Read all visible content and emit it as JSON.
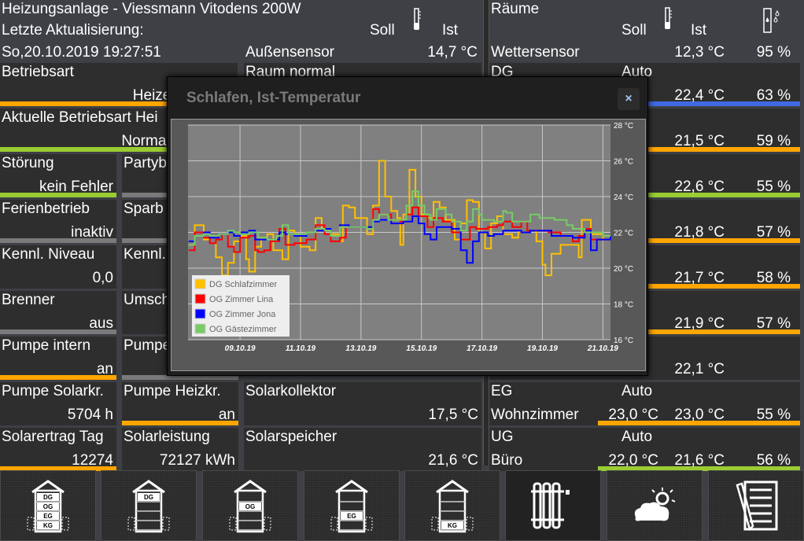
{
  "header": {
    "title": "Heizungsanlage - Viessmann Vitodens 200W",
    "last_update_label": "Letzte Aktualisierung:",
    "last_update_value": "So,20.10.2019 19:27:51",
    "soll": "Soll",
    "ist": "Ist",
    "outdoor_label": "Außensensor",
    "outdoor_value": "14,7 °C"
  },
  "colors": {
    "orange": "#ffa500",
    "green": "#9acd32",
    "gray": "#7a7a7a",
    "blue": "#4169e1"
  },
  "left_tiles": [
    {
      "label": "Betriebsart",
      "value": "Heizen und Wa",
      "bar": "orange",
      "col": "wide",
      "row": 0
    },
    {
      "label": "Raum normal",
      "value": "",
      "bar": "",
      "col": "c3",
      "row": 0
    },
    {
      "label": "Aktuelle Betriebsart Hei",
      "value": "Normalbetrieb (S",
      "bar": "green",
      "col": "wide",
      "row": 1
    },
    {
      "label": "Störung",
      "value": "kein Fehler",
      "bar": "green",
      "col": "c1",
      "row": 2
    },
    {
      "label": "Partyb",
      "value": "",
      "bar": "gray",
      "col": "c2",
      "row": 2
    },
    {
      "label": "Ferienbetrieb",
      "value": "inaktiv",
      "bar": "gray",
      "col": "c1",
      "row": 3
    },
    {
      "label": "Sparb",
      "value": "",
      "bar": "gray",
      "col": "c2",
      "row": 3
    },
    {
      "label": "Kennl. Niveau",
      "value": "0,0",
      "bar": "",
      "col": "c1",
      "row": 4
    },
    {
      "label": "Kennl.",
      "value": "",
      "bar": "",
      "col": "c2",
      "row": 4
    },
    {
      "label": "Brenner",
      "value": "aus",
      "bar": "gray",
      "col": "c1",
      "row": 5
    },
    {
      "label": "Umsch",
      "value": "",
      "bar": "",
      "col": "c2",
      "row": 5
    },
    {
      "label": "Pumpe intern",
      "value": "an",
      "bar": "orange",
      "col": "c1",
      "row": 6
    },
    {
      "label": "Pumpe",
      "value": "",
      "bar": "gray",
      "col": "c2",
      "row": 6
    },
    {
      "label": "Pumpe Solarkr.",
      "value": "5704 h",
      "bar": "",
      "col": "c1",
      "row": 7
    },
    {
      "label": "Pumpe Heizkr.",
      "value": "an",
      "bar": "orange",
      "col": "c2",
      "row": 7
    },
    {
      "label": "Solarkollektor",
      "value": "17,5 °C",
      "bar": "",
      "col": "c3",
      "row": 7
    },
    {
      "label": "Solarertrag Tag",
      "value": "12274",
      "bar": "orange",
      "col": "c1",
      "row": 8
    },
    {
      "label": "Solarleistung",
      "value": "72127 kWh",
      "bar": "",
      "col": "c2",
      "row": 8
    },
    {
      "label": "Solarspeicher",
      "value": "21,6 °C",
      "bar": "",
      "col": "c3",
      "row": 8
    }
  ],
  "rooms": {
    "title": "Räume",
    "soll": "Soll",
    "ist": "Ist",
    "weather_label": "Wettersensor",
    "weather_temp": "12,3 °C",
    "weather_hum": "95 %",
    "rows": [
      {
        "n1": "DG",
        "n2": "",
        "mode": "Auto",
        "soll": "",
        "ist": "22,4 °C",
        "hum": "63 %",
        "bar": "blue"
      },
      {
        "n1": "",
        "n2": "",
        "mode": "",
        "soll": "",
        "ist": "21,5 °C",
        "hum": "59 %",
        "bar": "orange"
      },
      {
        "n1": "",
        "n2": "",
        "mode": "",
        "soll": "",
        "ist": "22,6 °C",
        "hum": "55 %",
        "bar": "green"
      },
      {
        "n1": "",
        "n2": "",
        "mode": "",
        "soll": "",
        "ist": "21,8 °C",
        "hum": "57 %",
        "bar": "orange"
      },
      {
        "n1": "",
        "n2": "",
        "mode": "",
        "soll": "",
        "ist": "21,7 °C",
        "hum": "58 %",
        "bar": "orange"
      },
      {
        "n1": "",
        "n2": "",
        "mode": "",
        "soll": "",
        "ist": "21,9 °C",
        "hum": "57 %",
        "bar": "orange"
      },
      {
        "n1": "",
        "n2": "",
        "mode": "",
        "soll": "",
        "ist": "22,1 °C",
        "hum": "",
        "bar": ""
      },
      {
        "n1": "EG",
        "n2": "Wohnzimmer",
        "mode": "Auto",
        "soll": "23,0 °C",
        "ist": "23,0 °C",
        "hum": "55 %",
        "bar": "orange"
      },
      {
        "n1": "UG",
        "n2": "Büro",
        "mode": "Auto",
        "soll": "22,0 °C",
        "ist": "21,6 °C",
        "hum": "56 %",
        "bar": "green"
      }
    ]
  },
  "nav": [
    {
      "name": "house-all-floors",
      "labels": [
        "DG",
        "OG",
        "EG",
        "KG"
      ],
      "hl": [
        0,
        1,
        2,
        3
      ]
    },
    {
      "name": "house-dg",
      "labels": [
        "DG"
      ],
      "hl": [
        0
      ]
    },
    {
      "name": "house-og",
      "labels": [
        "OG"
      ],
      "hl": [
        1
      ]
    },
    {
      "name": "house-eg",
      "labels": [
        "EG"
      ],
      "hl": [
        2
      ]
    },
    {
      "name": "house-kg",
      "labels": [
        "KG"
      ],
      "hl": [
        3
      ]
    },
    {
      "name": "radiator",
      "labels": [],
      "hl": [],
      "active": true
    },
    {
      "name": "weather",
      "labels": [],
      "hl": []
    },
    {
      "name": "notes",
      "labels": [],
      "hl": []
    }
  ],
  "dialog": {
    "title": "Schlafen, Ist-Temperatur",
    "close": "×"
  },
  "chart_data": {
    "type": "line",
    "title": "Schlafen, Ist-Temperatur",
    "x_unit": "days since 07.10.19 00:00",
    "xlim": [
      0.28,
      14.25
    ],
    "ylim": [
      16,
      28
    ],
    "yticks": [
      "16 °C",
      "18 °C",
      "20 °C",
      "22 °C",
      "24 °C",
      "26 °C",
      "28 °C"
    ],
    "ytick_values": [
      16,
      18,
      20,
      22,
      24,
      26,
      28
    ],
    "xticks": [
      "09.10.19",
      "11.10.19",
      "13.10.19",
      "15.10.19",
      "17.10.19",
      "19.10.19",
      "21.10.19"
    ],
    "xtick_values": [
      2,
      4,
      6,
      8,
      10,
      12,
      14
    ],
    "grid": true,
    "legend": "bottom-left",
    "series": [
      {
        "name": "DG Schlafzimmer",
        "color": "#ffc000",
        "points": [
          [
            0.3,
            21.3
          ],
          [
            0.5,
            22.4
          ],
          [
            0.8,
            21.6
          ],
          [
            1.0,
            21.8
          ],
          [
            1.2,
            20.6
          ],
          [
            1.4,
            19.6
          ],
          [
            1.6,
            20.3
          ],
          [
            1.8,
            21.5
          ],
          [
            2.0,
            21.8
          ],
          [
            2.2,
            20.5
          ],
          [
            2.3,
            19.8
          ],
          [
            2.5,
            21.2
          ],
          [
            2.7,
            21.7
          ],
          [
            2.9,
            21.9
          ],
          [
            3.1,
            21.0
          ],
          [
            3.4,
            20.5
          ],
          [
            3.6,
            22.1
          ],
          [
            3.8,
            21.9
          ],
          [
            4.0,
            21.2
          ],
          [
            4.3,
            21.0
          ],
          [
            4.5,
            22.8
          ],
          [
            4.7,
            22.2
          ],
          [
            5.0,
            21.9
          ],
          [
            5.3,
            21.5
          ],
          [
            5.4,
            23.5
          ],
          [
            5.6,
            23.4
          ],
          [
            5.8,
            22.8
          ],
          [
            6.2,
            21.9
          ],
          [
            6.4,
            23.5
          ],
          [
            6.6,
            26.0
          ],
          [
            6.8,
            24.0
          ],
          [
            7.0,
            23.2
          ],
          [
            7.2,
            22.8
          ],
          [
            7.3,
            21.3
          ],
          [
            7.4,
            23.0
          ],
          [
            7.6,
            25.5
          ],
          [
            7.8,
            24.0
          ],
          [
            8.0,
            23.0
          ],
          [
            8.2,
            22.8
          ],
          [
            8.4,
            23.7
          ],
          [
            8.6,
            23.4
          ],
          [
            8.8,
            22.7
          ],
          [
            9.1,
            21.6
          ],
          [
            9.3,
            22.5
          ],
          [
            9.5,
            23.8
          ],
          [
            9.7,
            23.7
          ],
          [
            9.9,
            22.0
          ],
          [
            10.1,
            21.1
          ],
          [
            10.3,
            22.5
          ],
          [
            10.5,
            22.9
          ],
          [
            10.7,
            21.9
          ],
          [
            11.0,
            21.7
          ],
          [
            11.2,
            22.0
          ],
          [
            11.5,
            22.1
          ],
          [
            11.8,
            21.5
          ],
          [
            12.0,
            20.2
          ],
          [
            12.1,
            19.6
          ],
          [
            12.3,
            20.8
          ],
          [
            12.6,
            21.3
          ],
          [
            13.0,
            21.3
          ],
          [
            13.2,
            20.6
          ],
          [
            13.3,
            22.7
          ],
          [
            13.6,
            21.9
          ],
          [
            14.0,
            21.6
          ],
          [
            14.25,
            21.8
          ]
        ]
      },
      {
        "name": "OG Zimmer Lina",
        "color": "#ff0000",
        "points": [
          [
            0.3,
            21.0
          ],
          [
            0.5,
            22.0
          ],
          [
            0.8,
            21.7
          ],
          [
            1.0,
            21.4
          ],
          [
            1.2,
            21.6
          ],
          [
            1.4,
            21.9
          ],
          [
            1.6,
            21.2
          ],
          [
            1.8,
            20.9
          ],
          [
            2.0,
            21.7
          ],
          [
            2.3,
            21.8
          ],
          [
            2.5,
            21.0
          ],
          [
            2.6,
            20.9
          ],
          [
            2.8,
            21.0
          ],
          [
            3.0,
            21.5
          ],
          [
            3.3,
            22.2
          ],
          [
            3.5,
            21.3
          ],
          [
            3.8,
            21.4
          ],
          [
            4.2,
            21.6
          ],
          [
            4.5,
            22.4
          ],
          [
            4.8,
            21.9
          ],
          [
            5.0,
            21.5
          ],
          [
            5.3,
            21.7
          ],
          [
            5.5,
            22.3
          ],
          [
            5.8,
            22.3
          ],
          [
            6.2,
            22.3
          ],
          [
            6.4,
            23.3
          ],
          [
            6.6,
            23.0
          ],
          [
            7.0,
            22.7
          ],
          [
            7.3,
            22.6
          ],
          [
            7.5,
            23.0
          ],
          [
            7.7,
            23.4
          ],
          [
            7.9,
            22.9
          ],
          [
            8.2,
            22.3
          ],
          [
            8.4,
            22.8
          ],
          [
            8.7,
            22.6
          ],
          [
            9.0,
            22.0
          ],
          [
            9.3,
            21.6
          ],
          [
            9.6,
            22.3
          ],
          [
            9.8,
            22.2
          ],
          [
            10.2,
            22.3
          ],
          [
            10.5,
            22.4
          ],
          [
            10.7,
            22.6
          ],
          [
            11.0,
            22.3
          ],
          [
            11.3,
            22.6
          ],
          [
            11.5,
            22.1
          ],
          [
            11.8,
            22.1
          ],
          [
            12.2,
            22.0
          ],
          [
            12.6,
            21.8
          ],
          [
            13.0,
            21.5
          ],
          [
            13.2,
            21.8
          ],
          [
            13.4,
            22.2
          ],
          [
            13.6,
            21.6
          ],
          [
            14.0,
            21.6
          ],
          [
            14.25,
            21.7
          ]
        ]
      },
      {
        "name": "OG Zimmer Jona",
        "color": "#0000ff",
        "points": [
          [
            0.3,
            21.5
          ],
          [
            0.5,
            21.8
          ],
          [
            0.8,
            22.0
          ],
          [
            1.0,
            21.7
          ],
          [
            1.3,
            21.9
          ],
          [
            1.6,
            22.0
          ],
          [
            1.8,
            21.8
          ],
          [
            2.0,
            22.0
          ],
          [
            2.3,
            22.1
          ],
          [
            2.5,
            21.6
          ],
          [
            2.8,
            21.6
          ],
          [
            3.0,
            21.6
          ],
          [
            3.3,
            22.0
          ],
          [
            3.5,
            21.9
          ],
          [
            3.8,
            21.8
          ],
          [
            4.2,
            22.0
          ],
          [
            4.5,
            22.1
          ],
          [
            4.8,
            22.2
          ],
          [
            5.0,
            21.8
          ],
          [
            5.3,
            22.4
          ],
          [
            5.6,
            22.3
          ],
          [
            6.2,
            22.3
          ],
          [
            6.4,
            22.6
          ],
          [
            6.6,
            22.7
          ],
          [
            7.0,
            22.5
          ],
          [
            7.4,
            22.6
          ],
          [
            7.7,
            22.9
          ],
          [
            7.9,
            22.5
          ],
          [
            8.1,
            21.9
          ],
          [
            8.3,
            21.6
          ],
          [
            8.5,
            22.3
          ],
          [
            9.0,
            22.2
          ],
          [
            9.3,
            21.0
          ],
          [
            9.5,
            20.3
          ],
          [
            9.7,
            21.5
          ],
          [
            9.9,
            22.0
          ],
          [
            10.2,
            21.8
          ],
          [
            10.4,
            21.9
          ],
          [
            10.7,
            22.1
          ],
          [
            11.0,
            22.1
          ],
          [
            11.3,
            22.0
          ],
          [
            11.6,
            22.1
          ],
          [
            11.9,
            22.1
          ],
          [
            12.3,
            21.8
          ],
          [
            12.7,
            21.8
          ],
          [
            13.0,
            21.7
          ],
          [
            13.2,
            21.7
          ],
          [
            13.4,
            22.1
          ],
          [
            13.6,
            21.0
          ],
          [
            13.8,
            21.6
          ],
          [
            14.25,
            21.8
          ]
        ]
      },
      {
        "name": "OG Gästezimmer",
        "color": "#77cc66",
        "points": [
          [
            0.3,
            21.3
          ],
          [
            0.5,
            21.8
          ],
          [
            0.8,
            21.9
          ],
          [
            1.0,
            21.8
          ],
          [
            1.3,
            21.9
          ],
          [
            1.6,
            22.1
          ],
          [
            1.8,
            22.0
          ],
          [
            2.0,
            21.9
          ],
          [
            2.3,
            22.0
          ],
          [
            2.6,
            21.7
          ],
          [
            2.9,
            21.6
          ],
          [
            3.2,
            21.8
          ],
          [
            3.4,
            22.4
          ],
          [
            3.6,
            21.9
          ],
          [
            3.9,
            21.9
          ],
          [
            4.2,
            22.0
          ],
          [
            4.5,
            22.2
          ],
          [
            4.8,
            22.1
          ],
          [
            5.0,
            21.8
          ],
          [
            5.3,
            22.3
          ],
          [
            6.2,
            22.2
          ],
          [
            6.4,
            22.7
          ],
          [
            6.6,
            23.0
          ],
          [
            6.9,
            22.7
          ],
          [
            7.2,
            22.7
          ],
          [
            7.5,
            23.5
          ],
          [
            7.7,
            24.3
          ],
          [
            7.9,
            23.5
          ],
          [
            8.1,
            23.0
          ],
          [
            8.3,
            22.7
          ],
          [
            8.5,
            23.3
          ],
          [
            8.8,
            23.0
          ],
          [
            9.0,
            22.6
          ],
          [
            9.3,
            22.1
          ],
          [
            9.5,
            22.6
          ],
          [
            9.7,
            23.3
          ],
          [
            9.9,
            23.0
          ],
          [
            10.0,
            22.7
          ],
          [
            10.4,
            22.6
          ],
          [
            10.7,
            23.2
          ],
          [
            10.8,
            23.1
          ],
          [
            11.0,
            22.6
          ],
          [
            11.5,
            22.6
          ],
          [
            11.6,
            23.0
          ],
          [
            11.9,
            22.8
          ],
          [
            12.4,
            22.7
          ],
          [
            12.8,
            22.4
          ],
          [
            13.0,
            22.2
          ],
          [
            13.4,
            22.0
          ],
          [
            13.6,
            22.0
          ],
          [
            14.0,
            21.8
          ],
          [
            14.25,
            21.8
          ]
        ]
      }
    ]
  }
}
